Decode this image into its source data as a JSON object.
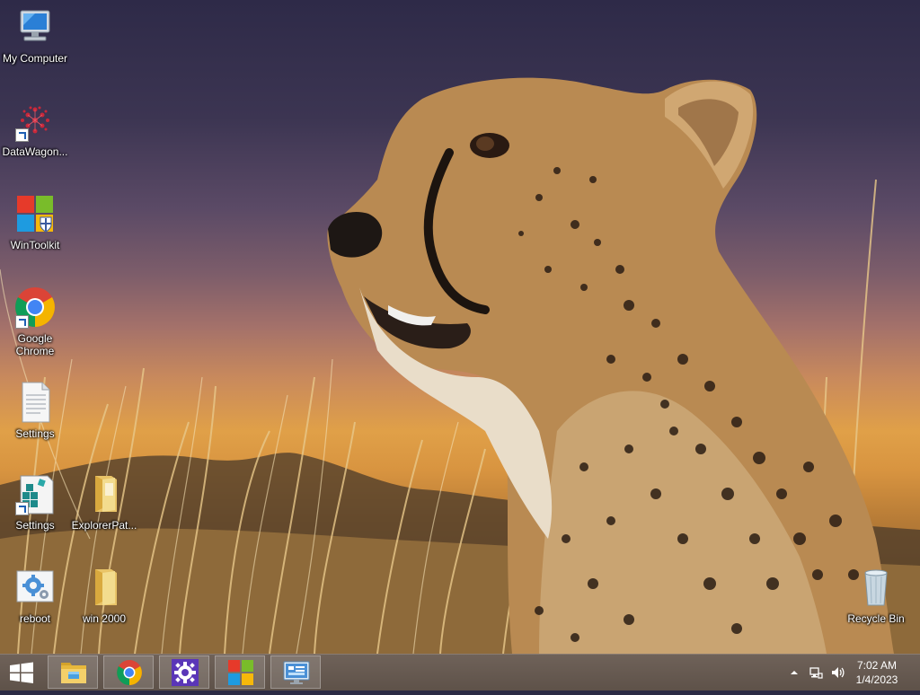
{
  "desktop": {
    "icons": [
      {
        "label": "My Computer",
        "icon": "computer-icon"
      },
      {
        "label": "DataWagon...",
        "icon": "datawagon-icon"
      },
      {
        "label": "WinToolkit",
        "icon": "wintoolkit-icon"
      },
      {
        "label": "Google Chrome",
        "icon": "chrome-icon"
      },
      {
        "label": "Settings",
        "icon": "document-icon"
      },
      {
        "label": "Settings",
        "icon": "registry-icon"
      },
      {
        "label": "ExplorerPat...",
        "icon": "folder-icon"
      },
      {
        "label": "reboot",
        "icon": "gear-icon"
      },
      {
        "label": "win 2000",
        "icon": "folder-icon"
      },
      {
        "label": "Recycle Bin",
        "icon": "recycle-bin-icon"
      }
    ]
  },
  "taskbar": {
    "start_icon": "windows-start-icon",
    "pinned": [
      {
        "icon": "file-explorer-icon"
      },
      {
        "icon": "chrome-icon"
      },
      {
        "icon": "settings-gear-icon"
      },
      {
        "icon": "windows-logo-icon"
      },
      {
        "icon": "control-panel-icon"
      }
    ],
    "tray": {
      "icons": [
        "show-hidden-icons-icon",
        "network-icon",
        "volume-icon"
      ]
    },
    "clock": {
      "time": "7:02 AM",
      "date": "1/4/2023"
    }
  },
  "colors": {
    "taskbar": "#5e5249",
    "wallpaper_top": "#2e2a48",
    "wallpaper_horizon": "#e0a048"
  }
}
